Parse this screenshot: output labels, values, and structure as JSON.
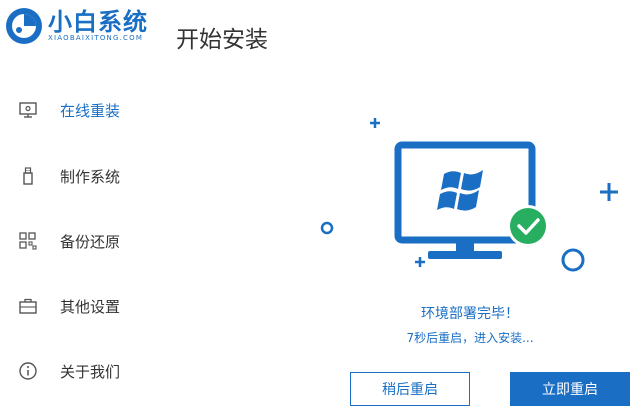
{
  "app": {
    "name": "小白系统",
    "subtitle": "XIAOBAIXITONG.COM",
    "brand_color": "#1a6fc4"
  },
  "page": {
    "title": "开始安装"
  },
  "sidebar": {
    "items": [
      {
        "label": "在线重装",
        "icon": "monitor-icon",
        "active": true
      },
      {
        "label": "制作系统",
        "icon": "usb-drive-icon",
        "active": false
      },
      {
        "label": "备份还原",
        "icon": "backup-grid-icon",
        "active": false
      },
      {
        "label": "其他设置",
        "icon": "briefcase-icon",
        "active": false
      },
      {
        "label": "关于我们",
        "icon": "info-icon",
        "active": false
      }
    ]
  },
  "status": {
    "title": "环境部署完毕！",
    "message": "7秒后重启，进入安装..."
  },
  "buttons": {
    "later": "稍后重启",
    "now": "立即重启"
  },
  "colors": {
    "accent": "#1a6fc4",
    "success": "#27ae60",
    "text": "#333333"
  }
}
